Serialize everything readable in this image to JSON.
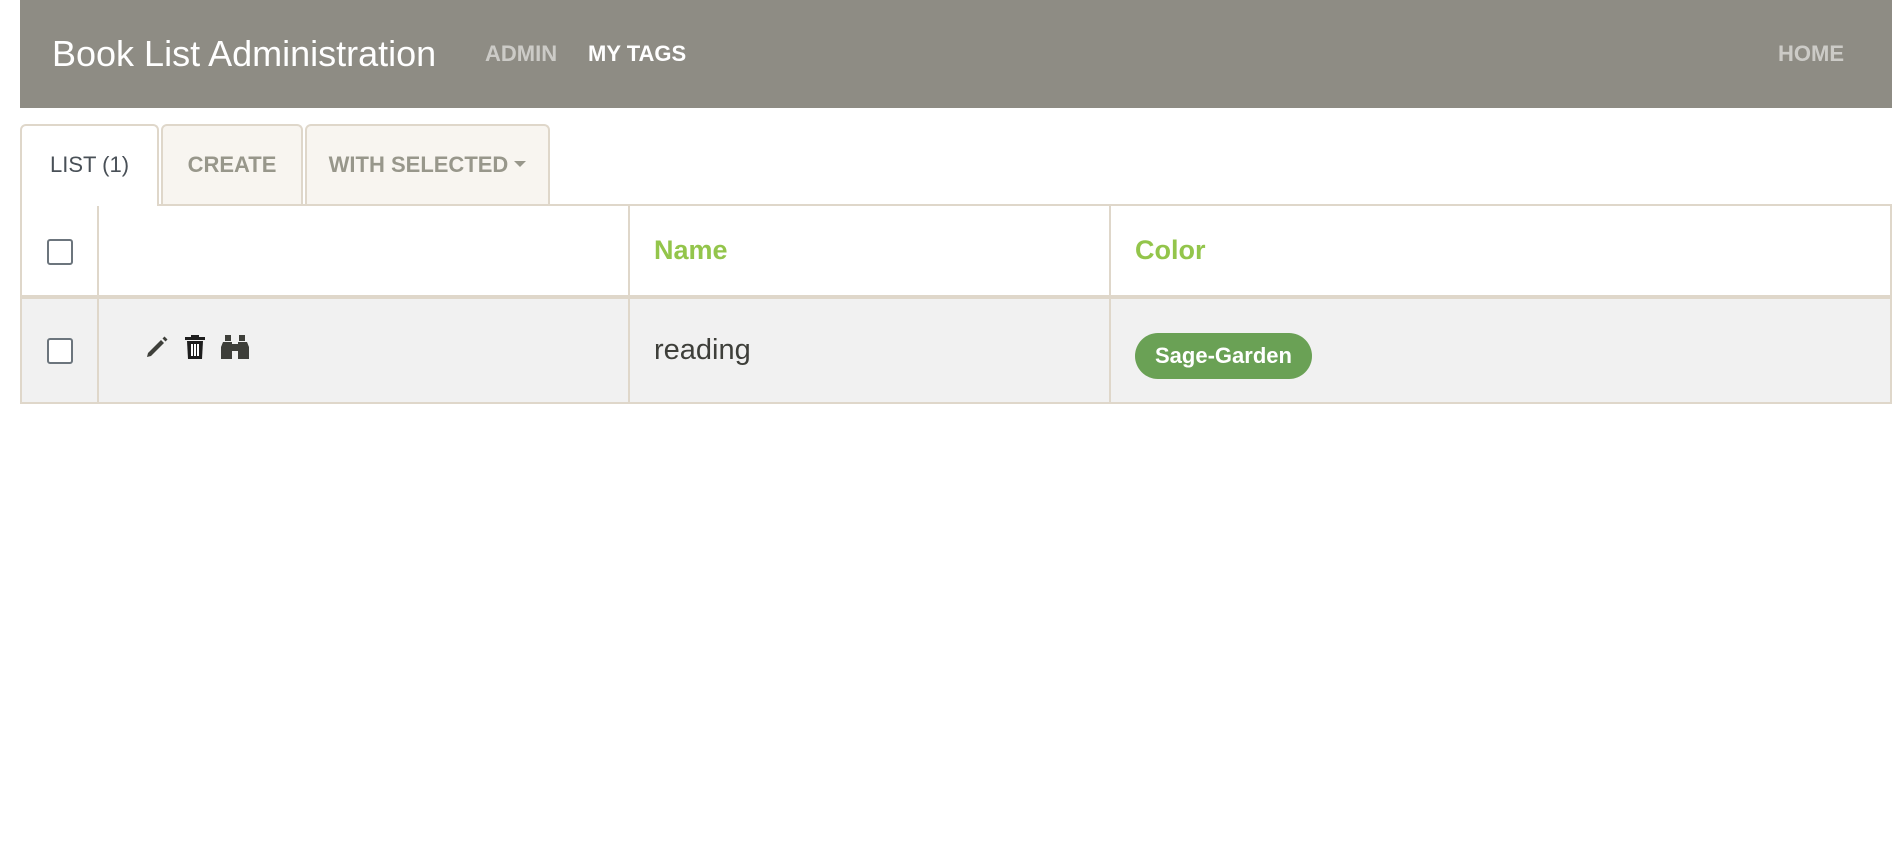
{
  "navbar": {
    "brand": "Book List Administration",
    "links": [
      {
        "label": "ADMIN"
      },
      {
        "label": "MY TAGS"
      }
    ],
    "home": "HOME"
  },
  "tabs": [
    {
      "label": "LIST (1)",
      "active": true
    },
    {
      "label": "CREATE",
      "active": false
    },
    {
      "label": "WITH SELECTED",
      "active": false,
      "dropdown": true
    }
  ],
  "table": {
    "columns": [
      "",
      "",
      "Name",
      "Color"
    ],
    "rows": [
      {
        "actions": [
          "pencil-icon",
          "trash-icon",
          "binoculars-icon"
        ],
        "name": "reading",
        "color": "Sage-Garden",
        "color_hex": "#6aa155"
      }
    ]
  },
  "colors": {
    "navbar": "#8e8c84",
    "header_text": "#93c54b",
    "border": "#dfd7ca",
    "row_background": "#f1f1f1"
  }
}
